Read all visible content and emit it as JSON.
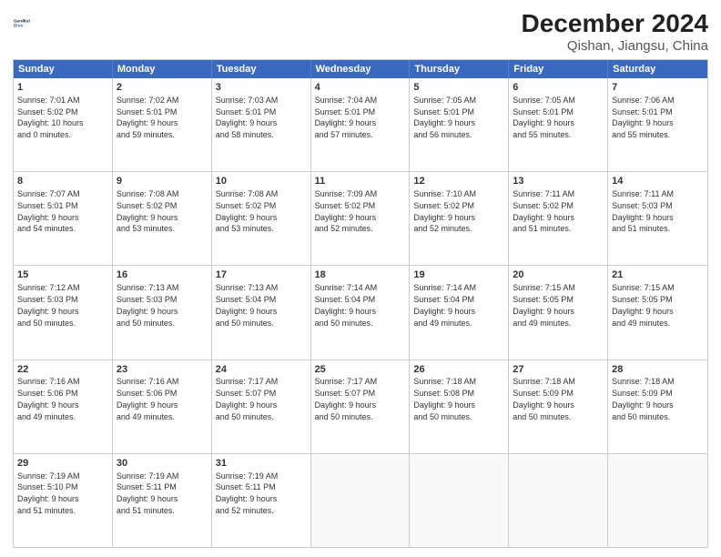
{
  "header": {
    "logo_line1": "General",
    "logo_line2": "Blue",
    "title": "December 2024",
    "subtitle": "Qishan, Jiangsu, China"
  },
  "days": [
    "Sunday",
    "Monday",
    "Tuesday",
    "Wednesday",
    "Thursday",
    "Friday",
    "Saturday"
  ],
  "weeks": [
    [
      {
        "day": "1",
        "info": "Sunrise: 7:01 AM\nSunset: 5:02 PM\nDaylight: 10 hours\nand 0 minutes."
      },
      {
        "day": "2",
        "info": "Sunrise: 7:02 AM\nSunset: 5:01 PM\nDaylight: 9 hours\nand 59 minutes."
      },
      {
        "day": "3",
        "info": "Sunrise: 7:03 AM\nSunset: 5:01 PM\nDaylight: 9 hours\nand 58 minutes."
      },
      {
        "day": "4",
        "info": "Sunrise: 7:04 AM\nSunset: 5:01 PM\nDaylight: 9 hours\nand 57 minutes."
      },
      {
        "day": "5",
        "info": "Sunrise: 7:05 AM\nSunset: 5:01 PM\nDaylight: 9 hours\nand 56 minutes."
      },
      {
        "day": "6",
        "info": "Sunrise: 7:05 AM\nSunset: 5:01 PM\nDaylight: 9 hours\nand 55 minutes."
      },
      {
        "day": "7",
        "info": "Sunrise: 7:06 AM\nSunset: 5:01 PM\nDaylight: 9 hours\nand 55 minutes."
      }
    ],
    [
      {
        "day": "8",
        "info": "Sunrise: 7:07 AM\nSunset: 5:01 PM\nDaylight: 9 hours\nand 54 minutes."
      },
      {
        "day": "9",
        "info": "Sunrise: 7:08 AM\nSunset: 5:02 PM\nDaylight: 9 hours\nand 53 minutes."
      },
      {
        "day": "10",
        "info": "Sunrise: 7:08 AM\nSunset: 5:02 PM\nDaylight: 9 hours\nand 53 minutes."
      },
      {
        "day": "11",
        "info": "Sunrise: 7:09 AM\nSunset: 5:02 PM\nDaylight: 9 hours\nand 52 minutes."
      },
      {
        "day": "12",
        "info": "Sunrise: 7:10 AM\nSunset: 5:02 PM\nDaylight: 9 hours\nand 52 minutes."
      },
      {
        "day": "13",
        "info": "Sunrise: 7:11 AM\nSunset: 5:02 PM\nDaylight: 9 hours\nand 51 minutes."
      },
      {
        "day": "14",
        "info": "Sunrise: 7:11 AM\nSunset: 5:03 PM\nDaylight: 9 hours\nand 51 minutes."
      }
    ],
    [
      {
        "day": "15",
        "info": "Sunrise: 7:12 AM\nSunset: 5:03 PM\nDaylight: 9 hours\nand 50 minutes."
      },
      {
        "day": "16",
        "info": "Sunrise: 7:13 AM\nSunset: 5:03 PM\nDaylight: 9 hours\nand 50 minutes."
      },
      {
        "day": "17",
        "info": "Sunrise: 7:13 AM\nSunset: 5:04 PM\nDaylight: 9 hours\nand 50 minutes."
      },
      {
        "day": "18",
        "info": "Sunrise: 7:14 AM\nSunset: 5:04 PM\nDaylight: 9 hours\nand 50 minutes."
      },
      {
        "day": "19",
        "info": "Sunrise: 7:14 AM\nSunset: 5:04 PM\nDaylight: 9 hours\nand 49 minutes."
      },
      {
        "day": "20",
        "info": "Sunrise: 7:15 AM\nSunset: 5:05 PM\nDaylight: 9 hours\nand 49 minutes."
      },
      {
        "day": "21",
        "info": "Sunrise: 7:15 AM\nSunset: 5:05 PM\nDaylight: 9 hours\nand 49 minutes."
      }
    ],
    [
      {
        "day": "22",
        "info": "Sunrise: 7:16 AM\nSunset: 5:06 PM\nDaylight: 9 hours\nand 49 minutes."
      },
      {
        "day": "23",
        "info": "Sunrise: 7:16 AM\nSunset: 5:06 PM\nDaylight: 9 hours\nand 49 minutes."
      },
      {
        "day": "24",
        "info": "Sunrise: 7:17 AM\nSunset: 5:07 PM\nDaylight: 9 hours\nand 50 minutes."
      },
      {
        "day": "25",
        "info": "Sunrise: 7:17 AM\nSunset: 5:07 PM\nDaylight: 9 hours\nand 50 minutes."
      },
      {
        "day": "26",
        "info": "Sunrise: 7:18 AM\nSunset: 5:08 PM\nDaylight: 9 hours\nand 50 minutes."
      },
      {
        "day": "27",
        "info": "Sunrise: 7:18 AM\nSunset: 5:09 PM\nDaylight: 9 hours\nand 50 minutes."
      },
      {
        "day": "28",
        "info": "Sunrise: 7:18 AM\nSunset: 5:09 PM\nDaylight: 9 hours\nand 50 minutes."
      }
    ],
    [
      {
        "day": "29",
        "info": "Sunrise: 7:19 AM\nSunset: 5:10 PM\nDaylight: 9 hours\nand 51 minutes."
      },
      {
        "day": "30",
        "info": "Sunrise: 7:19 AM\nSunset: 5:11 PM\nDaylight: 9 hours\nand 51 minutes."
      },
      {
        "day": "31",
        "info": "Sunrise: 7:19 AM\nSunset: 5:11 PM\nDaylight: 9 hours\nand 52 minutes."
      },
      {
        "day": "",
        "info": ""
      },
      {
        "day": "",
        "info": ""
      },
      {
        "day": "",
        "info": ""
      },
      {
        "day": "",
        "info": ""
      }
    ]
  ]
}
